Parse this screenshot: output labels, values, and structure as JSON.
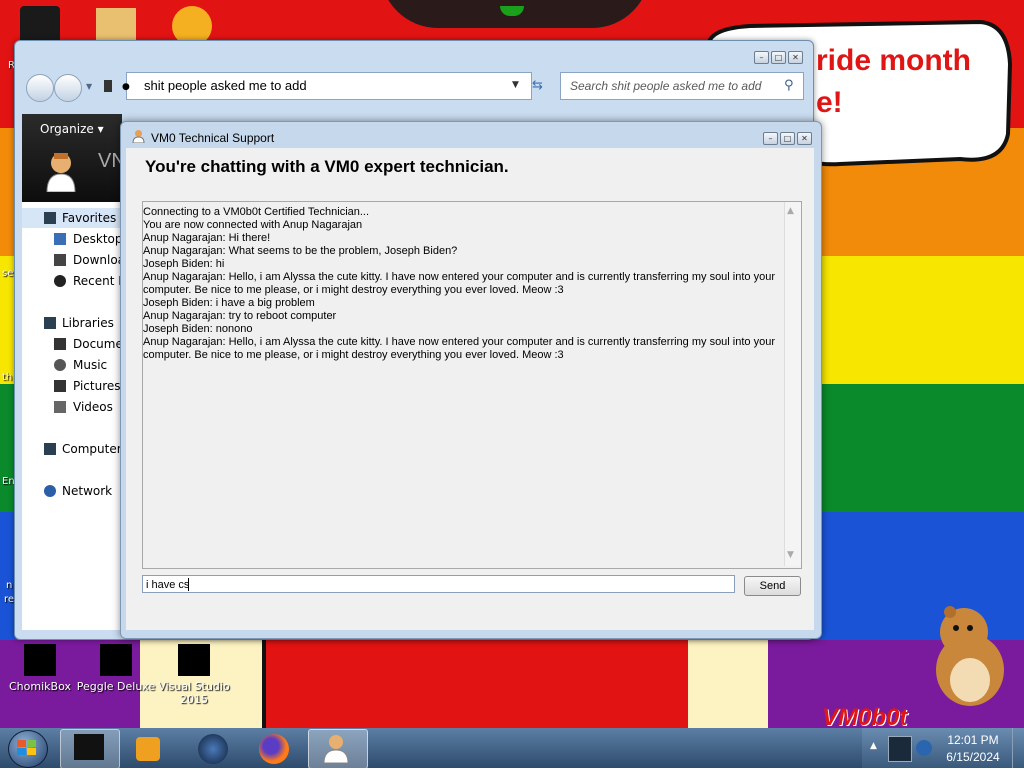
{
  "desktop": {
    "banner": {
      "line1": "ride month",
      "line2": "e!"
    },
    "edge_labels": {
      "top_left": "R",
      "mid_left_1": "se",
      "mid_left_2": "th",
      "mid_left_3": "En",
      "low_left": "n",
      "low_left_2": "re"
    },
    "icons": [
      {
        "label": "ChomikBox",
        "icon": "chomikbox-icon"
      },
      {
        "label": "Peggle Deluxe",
        "icon": "peggle-icon"
      },
      {
        "label": "Visual Studio 2015",
        "icon": "visual-studio-icon"
      }
    ],
    "watermark": "VM0b0t",
    "colors": {
      "red": "#e21313",
      "orange": "#f28a0a",
      "yellow": "#f7e600",
      "green": "#0a8a2a",
      "blue": "#1a53d6",
      "purple": "#7a1a9c"
    }
  },
  "explorer": {
    "address": "shit people asked me to add",
    "search_placeholder": "Search shit people asked me to add",
    "organize_label": "Organize",
    "header_partial": "VN",
    "nav": {
      "favorites": "Favorites",
      "desktop": "Desktop",
      "downloads": "Downloa",
      "recent": "Recent P",
      "libraries": "Libraries",
      "documents": "Documer",
      "music": "Music",
      "pictures": "Pictures",
      "videos": "Videos",
      "computer": "Computer",
      "network": "Network"
    }
  },
  "support": {
    "title": "VM0 Technical Support",
    "heading": "You're chatting with a VM0 expert technician.",
    "chat": [
      "Connecting to a VM0b0t Certified Technician...",
      "You are now connected with Anup Nagarajan",
      "Anup Nagarajan: Hi there!",
      "Anup Nagarajan: What seems to be the problem, Joseph Biden?",
      "Joseph Biden: hi",
      "Anup Nagarajan: Hello, i am Alyssa the cute kitty. I have now entered your computer and is currently transferring my soul into your",
      "computer. Be nice to me please, or i might destroy everything you ever loved. Meow :3",
      "Joseph Biden: i have a big problem",
      "Anup Nagarajan: try to reboot computer",
      "Joseph Biden: nonono",
      "Anup Nagarajan: Hello, i am Alyssa the cute kitty. I have now entered your computer and is currently transferring my soul into your",
      "computer. Be nice to me please, or i might destroy everything you ever loved. Meow :3"
    ],
    "input_value": "i have cs",
    "send_label": "Send"
  },
  "taskbar": {
    "time": "12:01 PM",
    "date": "6/15/2024"
  }
}
